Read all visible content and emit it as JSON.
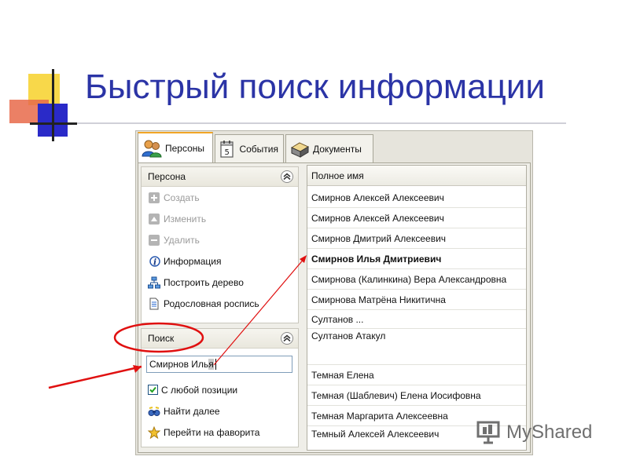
{
  "slide": {
    "title": "Быстрый поиск информации",
    "watermark": "MyShared"
  },
  "tabs": [
    {
      "label": "Персоны",
      "icon": "persons-icon",
      "active": true
    },
    {
      "label": "События",
      "icon": "events-icon",
      "active": false
    },
    {
      "label": "Документы",
      "icon": "documents-icon",
      "active": false
    }
  ],
  "person_panel": {
    "title": "Персона",
    "items": [
      {
        "label": "Создать",
        "icon": "plus-icon",
        "enabled": false
      },
      {
        "label": "Изменить",
        "icon": "edit-icon",
        "enabled": false
      },
      {
        "label": "Удалить",
        "icon": "minus-icon",
        "enabled": false
      },
      {
        "label": "Информация",
        "icon": "info-icon",
        "enabled": true
      },
      {
        "label": "Построить дерево",
        "icon": "tree-icon",
        "enabled": true
      },
      {
        "label": "Родословная роспись",
        "icon": "document-icon",
        "enabled": true
      }
    ]
  },
  "search_panel": {
    "title": "Поиск",
    "input_value": "Смирнов Илья",
    "any_position_label": "С любой позиции",
    "any_position_checked": true,
    "find_next_label": "Найти далее",
    "goto_favorite_label": "Перейти на фаворита"
  },
  "list": {
    "column_header": "Полное имя",
    "rows": [
      "Смирнов Алексей Алексеевич",
      "Смирнов Алексей Алексеевич",
      "Смирнов Дмитрий Алексеевич",
      "Смирнов Илья Дмитриевич",
      "Смирнова (Калинкина) Вера Александровна",
      "Смирнова Матрёна Никитична",
      "Султанов ...",
      "Султанов Атакул",
      "Темная Елена",
      "Темная (Шаблевич) Елена Иосифовна",
      "Темная Маргарита Алексеевна",
      "Темный Алексей Алексеевич"
    ],
    "selected_row": 3
  },
  "colors": {
    "title": "#2b34a6",
    "annotation": "#e01010",
    "tab_active_accent": "#f1a526"
  }
}
